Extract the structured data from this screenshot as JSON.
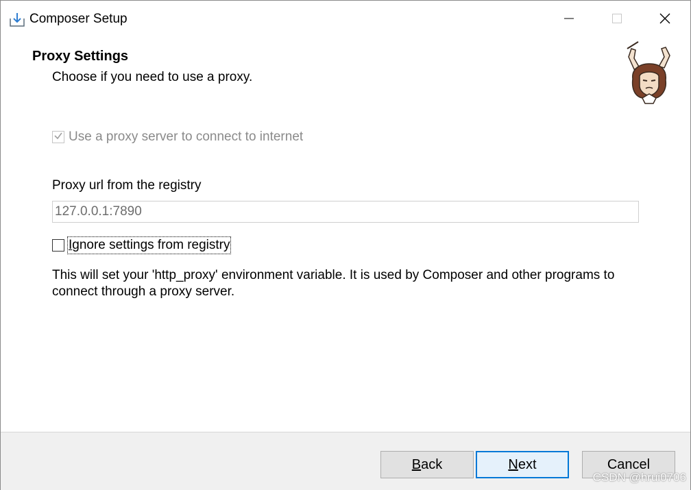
{
  "window": {
    "title": "Composer Setup"
  },
  "header": {
    "title": "Proxy Settings",
    "subtitle": "Choose if you need to use a proxy."
  },
  "proxy": {
    "use_proxy_label": "Use a proxy server to connect to internet",
    "use_proxy_checked": true,
    "use_proxy_disabled": true,
    "url_label": "Proxy url from the registry",
    "url_value": "127.0.0.1:7890",
    "ignore_label_accesskey": "I",
    "ignore_label_rest": "gnore settings from registry",
    "ignore_checked": false,
    "description": "This will set your 'http_proxy' environment variable. It is used by Composer and other programs to connect through a proxy server."
  },
  "footer": {
    "back_accesskey": "B",
    "back_rest": "ack",
    "next_accesskey": "N",
    "next_rest": "ext",
    "cancel_label": "Cancel"
  },
  "watermark": "CSDN @hrui0706",
  "icons": {
    "app": "installer-download-icon",
    "minimize": "minimize-icon",
    "maximize": "maximize-icon",
    "close": "close-icon",
    "mascot": "composer-mascot-image",
    "check": "checkmark-icon"
  }
}
